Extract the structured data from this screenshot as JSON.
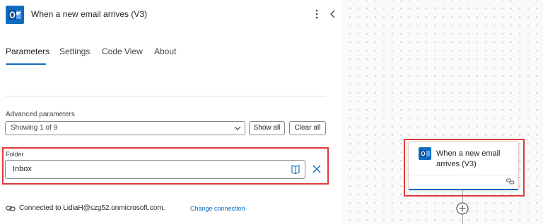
{
  "panel": {
    "title": "When a new email arrives (V3)",
    "tabs": [
      {
        "label": "Parameters",
        "active": true
      },
      {
        "label": "Settings",
        "active": false
      },
      {
        "label": "Code View",
        "active": false
      },
      {
        "label": "About",
        "active": false
      }
    ],
    "advanced": {
      "label": "Advanced parameters",
      "dropdown_value": "Showing 1 of 9",
      "show_all_label": "Show all",
      "clear_all_label": "Clear all"
    },
    "folder": {
      "label": "Folder",
      "value": "Inbox"
    },
    "connection": {
      "text": "Connected to LidiaH@szg52.onmicrosoft.com.",
      "change_link": "Change connection"
    }
  },
  "canvas": {
    "card_title": "When a new email arrives (V3)"
  },
  "icons": {
    "app": "outlook-icon",
    "more": "more-vertical-icon",
    "collapse": "chevron-left-icon",
    "dropdown": "chevron-down-icon",
    "browse": "folder-browse-icon",
    "clear": "close-icon",
    "connection": "link-icon",
    "add": "add-circle-icon"
  },
  "colors": {
    "accent": "#0f6cbd",
    "highlight": "#e03a3a"
  }
}
